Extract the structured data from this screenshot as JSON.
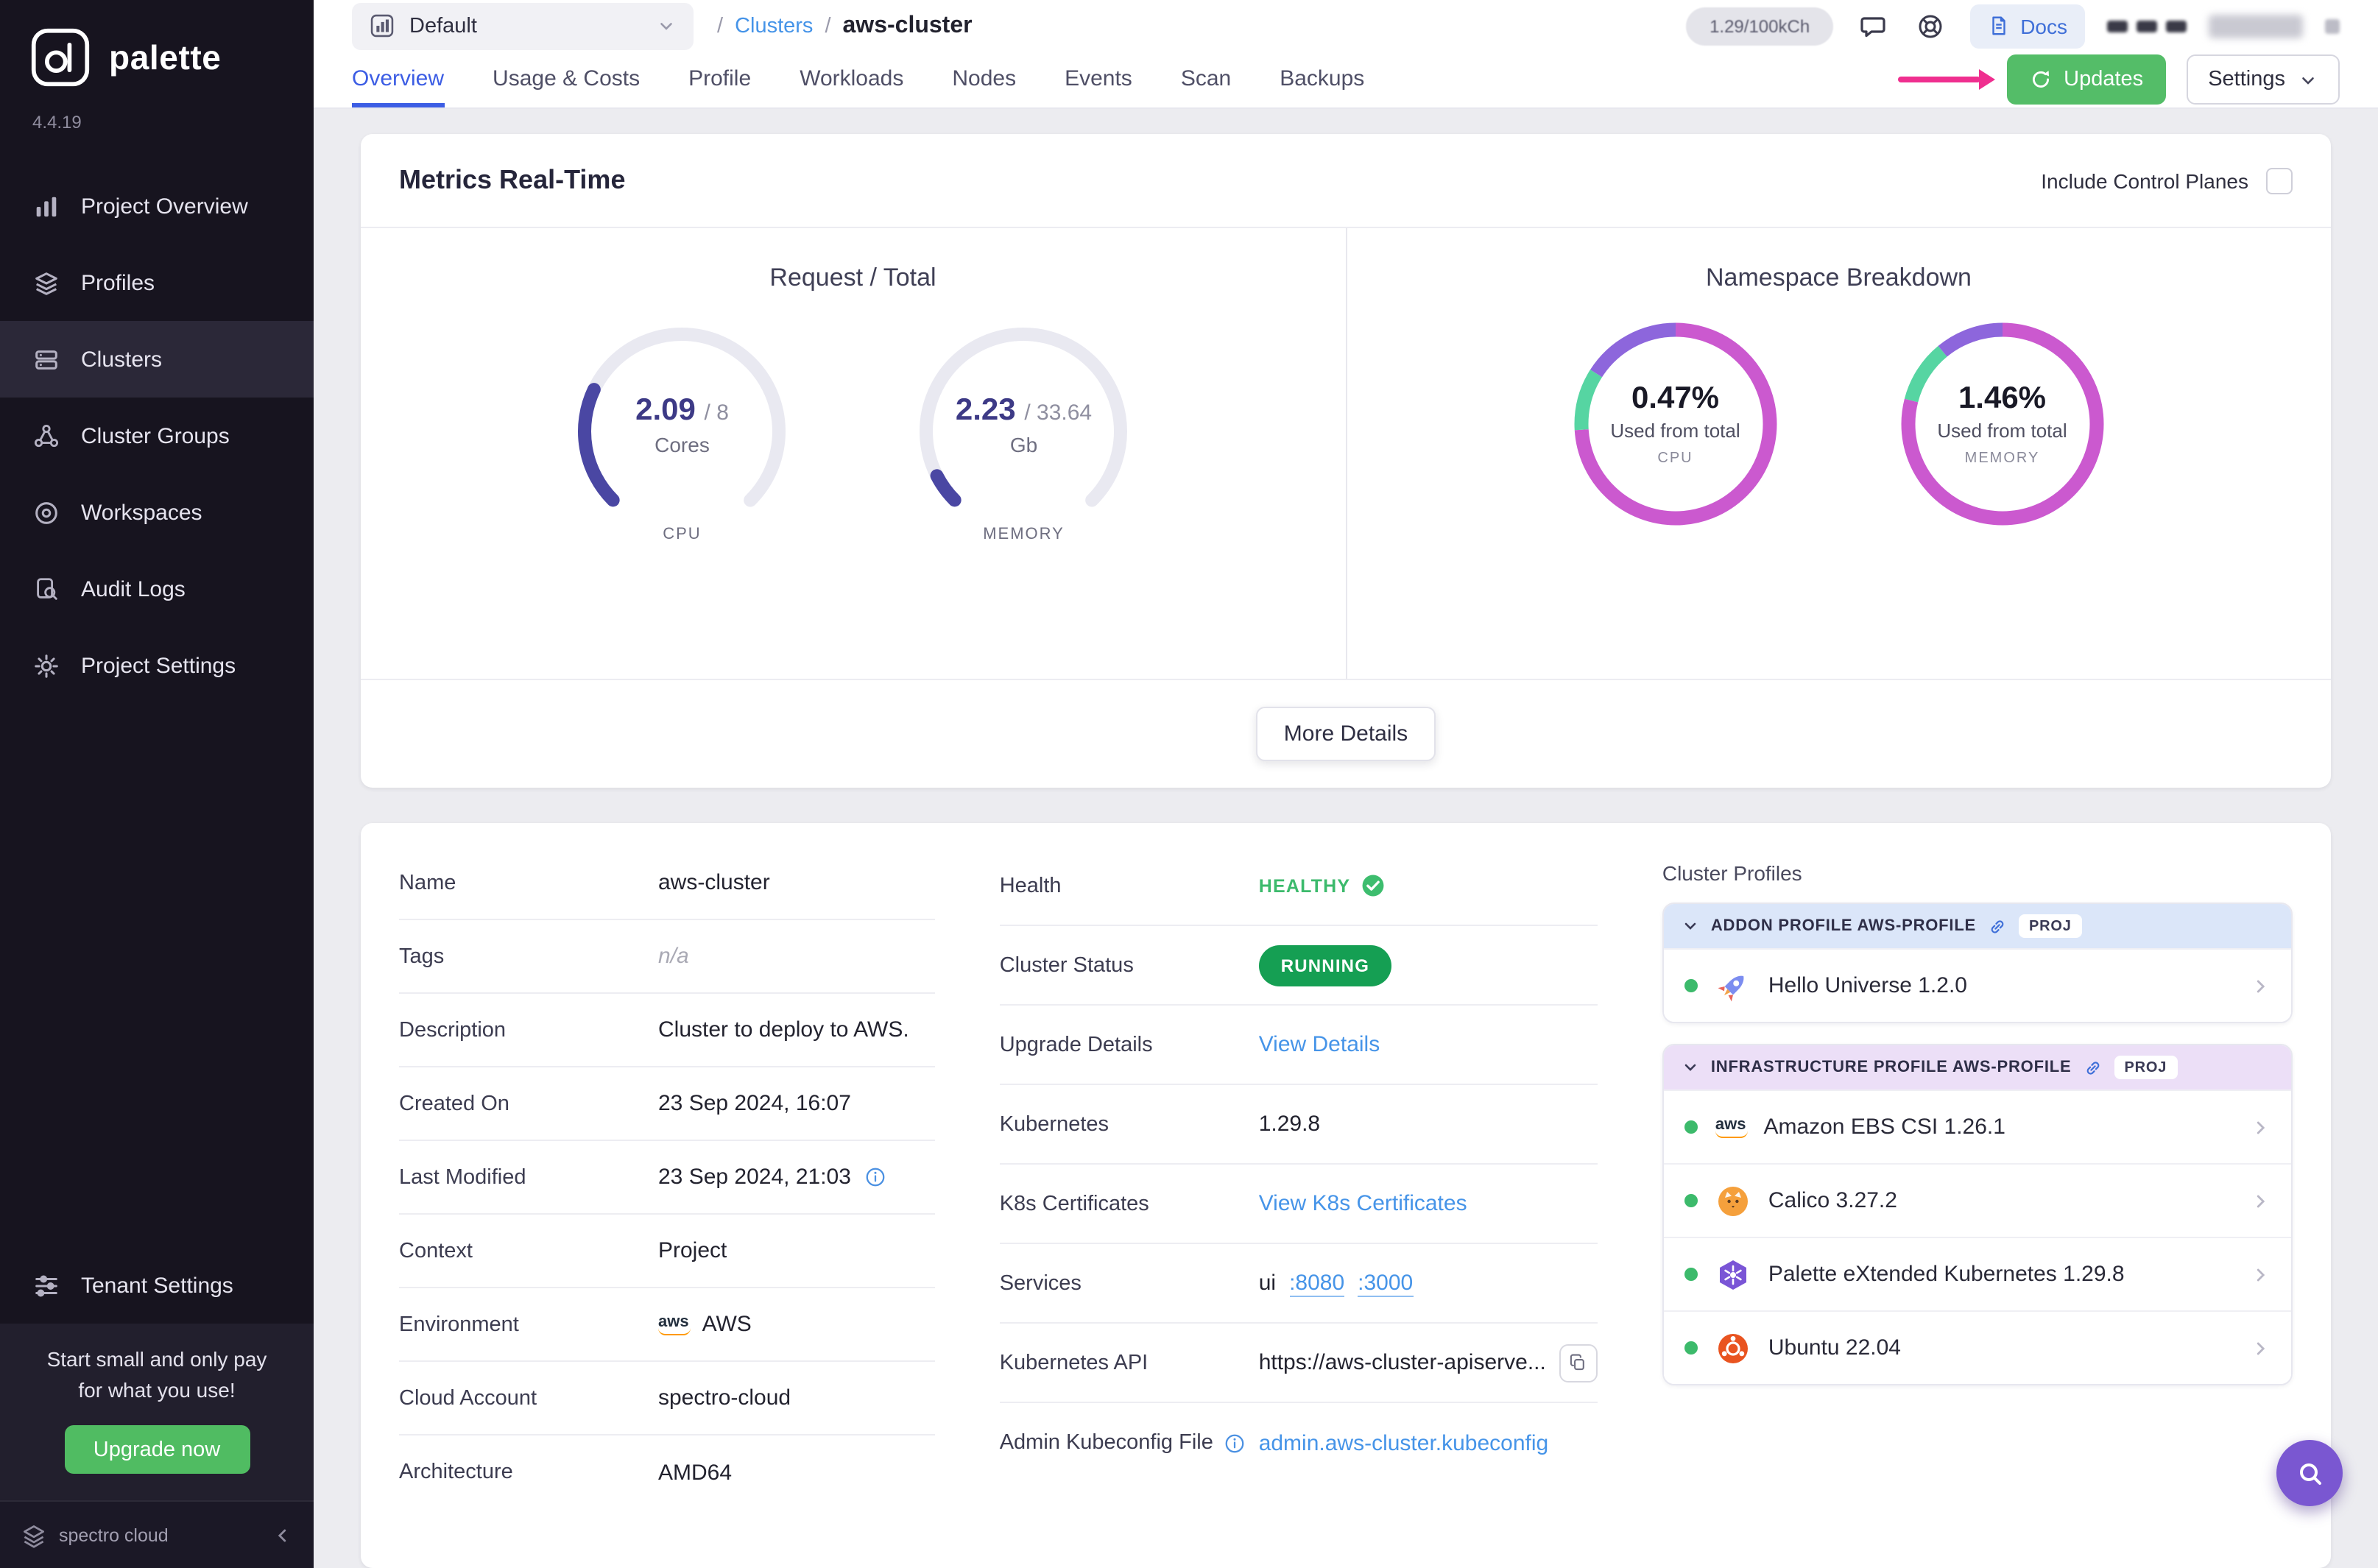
{
  "sidebar": {
    "brand": "palette",
    "version": "4.4.19",
    "items": [
      {
        "label": "Project Overview",
        "icon": "bar-chart-icon"
      },
      {
        "label": "Profiles",
        "icon": "layers-icon"
      },
      {
        "label": "Clusters",
        "icon": "list-icon",
        "active": true
      },
      {
        "label": "Cluster Groups",
        "icon": "nodes-icon"
      },
      {
        "label": "Workspaces",
        "icon": "target-icon"
      },
      {
        "label": "Audit Logs",
        "icon": "doc-search-icon"
      },
      {
        "label": "Project Settings",
        "icon": "gear-icon"
      }
    ],
    "tenant_settings": "Tenant Settings",
    "promo_line1": "Start small and only pay",
    "promo_line2": "for what you use!",
    "upgrade_button": "Upgrade now",
    "footer_brand": "spectro cloud"
  },
  "header": {
    "project_selector": "Default",
    "breadcrumb": {
      "separator": "/",
      "root": "Clusters",
      "current": "aws-cluster"
    },
    "usage_pill": "1.29/100kCh",
    "docs_label": "Docs",
    "icons": [
      "chat-icon",
      "help-icon",
      "docs-icon"
    ]
  },
  "tabs": [
    {
      "label": "Overview",
      "active": true
    },
    {
      "label": "Usage & Costs"
    },
    {
      "label": "Profile"
    },
    {
      "label": "Workloads"
    },
    {
      "label": "Nodes"
    },
    {
      "label": "Events"
    },
    {
      "label": "Scan"
    },
    {
      "label": "Backups"
    }
  ],
  "actions": {
    "updates": "Updates",
    "settings": "Settings"
  },
  "metrics": {
    "title": "Metrics Real-Time",
    "include_control_planes": "Include Control Planes",
    "more_details": "More Details",
    "request_total": {
      "title": "Request / Total",
      "arc_color": "#4a47a3",
      "track_color": "#e9e9f1",
      "gauges": [
        {
          "value": "2.09",
          "total_display": "/ 8",
          "unit": "Cores",
          "label": "CPU",
          "fraction": 0.261
        },
        {
          "value": "2.23",
          "total_display": "/ 33.64",
          "unit": "Gb",
          "label": "MEMORY",
          "fraction": 0.066
        }
      ]
    },
    "namespace_breakdown": {
      "title": "Namespace Breakdown",
      "donuts": [
        {
          "pct": "0.47%",
          "caption": "Used from total",
          "label": "CPU",
          "segments": [
            {
              "color": "#cb59cf",
              "pct": 74
            },
            {
              "color": "#56d5a2",
              "pct": 10
            },
            {
              "color": "#8d66dc",
              "pct": 16
            }
          ]
        },
        {
          "pct": "1.46%",
          "caption": "Used from total",
          "label": "MEMORY",
          "segments": [
            {
              "color": "#cb59cf",
              "pct": 79
            },
            {
              "color": "#56d5a2",
              "pct": 10
            },
            {
              "color": "#8d66dc",
              "pct": 11
            }
          ]
        }
      ]
    }
  },
  "details": {
    "left": [
      {
        "label": "Name",
        "value": "aws-cluster"
      },
      {
        "label": "Tags",
        "value": "n/a"
      },
      {
        "label": "Description",
        "value": "Cluster to deploy to AWS."
      },
      {
        "label": "Created On",
        "value": "23 Sep 2024, 16:07"
      },
      {
        "label": "Last Modified",
        "value": "23 Sep 2024, 21:03"
      },
      {
        "label": "Context",
        "value": "Project"
      },
      {
        "label": "Environment",
        "value": "AWS",
        "icon": "aws-icon"
      },
      {
        "label": "Cloud Account",
        "value": "spectro-cloud"
      },
      {
        "label": "Architecture",
        "value": "AMD64"
      }
    ],
    "right": [
      {
        "label": "Health",
        "value": "HEALTHY",
        "icon": "check-circle-icon"
      },
      {
        "label": "Cluster Status",
        "value": "RUNNING"
      },
      {
        "label": "Upgrade Details",
        "value": "View Details"
      },
      {
        "label": "Kubernetes",
        "value": "1.29.8"
      },
      {
        "label": "K8s Certificates",
        "value": "View K8s Certificates"
      },
      {
        "label": "Services",
        "value": "ui",
        "link1": ":8080",
        "link2": ":3000"
      },
      {
        "label": "Kubernetes API",
        "value": "https://aws-cluster-apiserve...",
        "icon": "copy-icon"
      },
      {
        "label": "Admin Kubeconfig File",
        "value": "admin.aws-cluster.kubeconfig",
        "icon": "info-icon"
      }
    ]
  },
  "cluster_profiles": {
    "title": "Cluster Profiles",
    "groups": [
      {
        "header": "ADDON PROFILE AWS-PROFILE",
        "badge": "PROJ",
        "icon": "link-icon",
        "items": [
          {
            "name": "Hello Universe 1.2.0",
            "icon": "rocket-icon"
          }
        ]
      },
      {
        "header": "INFRASTRUCTURE PROFILE AWS-PROFILE",
        "badge": "PROJ",
        "icon": "link-icon",
        "items": [
          {
            "name": "Amazon EBS CSI 1.26.1",
            "icon": "aws-icon"
          },
          {
            "name": "Calico 3.27.2",
            "icon": "calico-icon"
          },
          {
            "name": "Palette eXtended Kubernetes 1.29.8",
            "icon": "pxk-icon"
          },
          {
            "name": "Ubuntu 22.04",
            "icon": "ubuntu-icon"
          }
        ]
      }
    ]
  }
}
